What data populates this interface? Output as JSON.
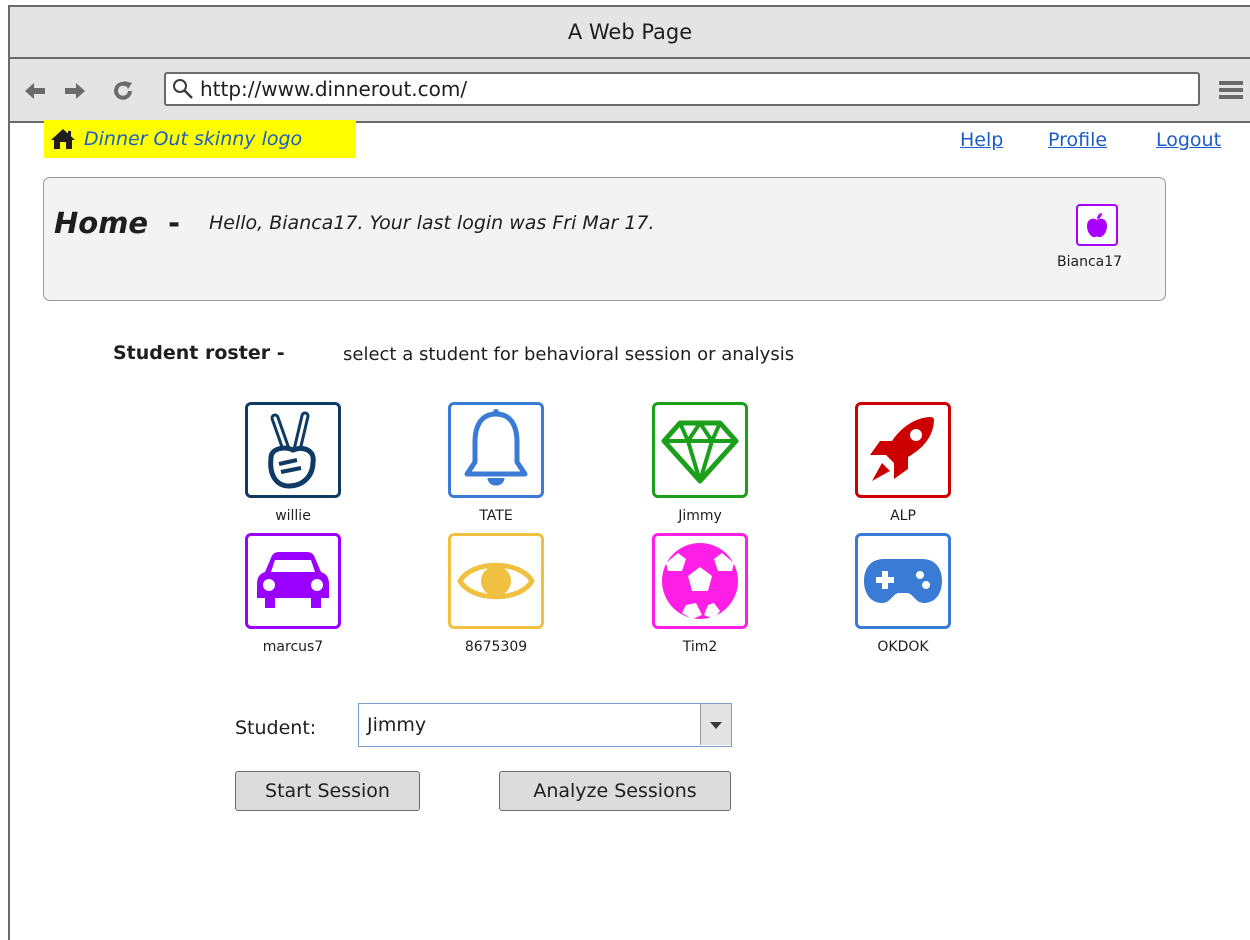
{
  "window": {
    "title": "A Web Page"
  },
  "browser": {
    "url": "http://www.dinnerout.com/"
  },
  "header": {
    "logo_text": "Dinner Out skinny logo",
    "links": {
      "help": "Help",
      "profile": "Profile",
      "logout": "Logout"
    }
  },
  "home": {
    "title": "Home",
    "dash": "-",
    "greeting": "Hello, Bianca17. Your last login was Fri Mar 17.",
    "user": {
      "name": "Bianca17",
      "icon": "apple-icon",
      "color": "#aa00ff"
    }
  },
  "roster": {
    "title": "Student roster -",
    "subtitle": "select a student for behavioral session or analysis",
    "students": [
      {
        "name": "willie",
        "icon": "peace-hand-icon",
        "color": "#0f3a63"
      },
      {
        "name": "TATE",
        "icon": "bell-icon",
        "color": "#3a7bd5"
      },
      {
        "name": "Jimmy",
        "icon": "diamond-icon",
        "color": "#1ca01c"
      },
      {
        "name": "ALP",
        "icon": "rocket-icon",
        "color": "#cc0000"
      },
      {
        "name": "marcus7",
        "icon": "car-icon",
        "color": "#9a00ff"
      },
      {
        "name": "8675309",
        "icon": "eye-icon",
        "color": "#f0c040"
      },
      {
        "name": "Tim2",
        "icon": "soccer-ball-icon",
        "color": "#ff1ee6"
      },
      {
        "name": "OKDOK",
        "icon": "gamepad-icon",
        "color": "#3a7bd5"
      }
    ]
  },
  "form": {
    "student_label": "Student:",
    "selected_student": "Jimmy",
    "start_button": "Start Session",
    "analyze_button": "Analyze Sessions"
  }
}
